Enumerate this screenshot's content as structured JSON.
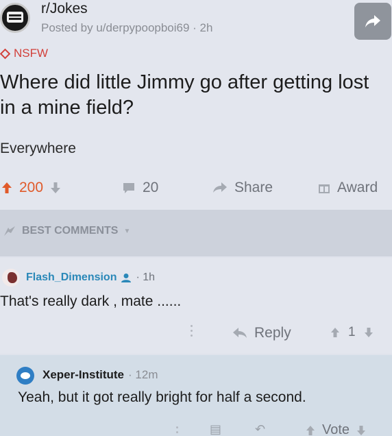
{
  "post": {
    "subreddit": "r/Jokes",
    "posted_by": "Posted by u/derpypoopboi69 · 2h",
    "nsfw_tag": "NSFW",
    "title": "Where did little Jimmy go after getting lost in a mine field?",
    "body": "Everywhere",
    "actions": {
      "upvotes": "200",
      "comments": "20",
      "share_label": "Share",
      "award_label": "Award"
    }
  },
  "sorter": {
    "label": "BEST COMMENTS"
  },
  "comments": [
    {
      "author": "Flash_Dimension",
      "time": "· 1h",
      "text": "That's really dark , mate ......",
      "reply_label": "Reply",
      "votes": "1"
    },
    {
      "author": "Xeper-Institute",
      "time": "· 12m",
      "text": "Yeah, but it got really bright for half a second.",
      "vote_label": "Vote"
    }
  ],
  "colors": {
    "upvote_accent": "#e05a2a",
    "nsfw": "#d2403a",
    "author_link": "#2a88b8"
  }
}
